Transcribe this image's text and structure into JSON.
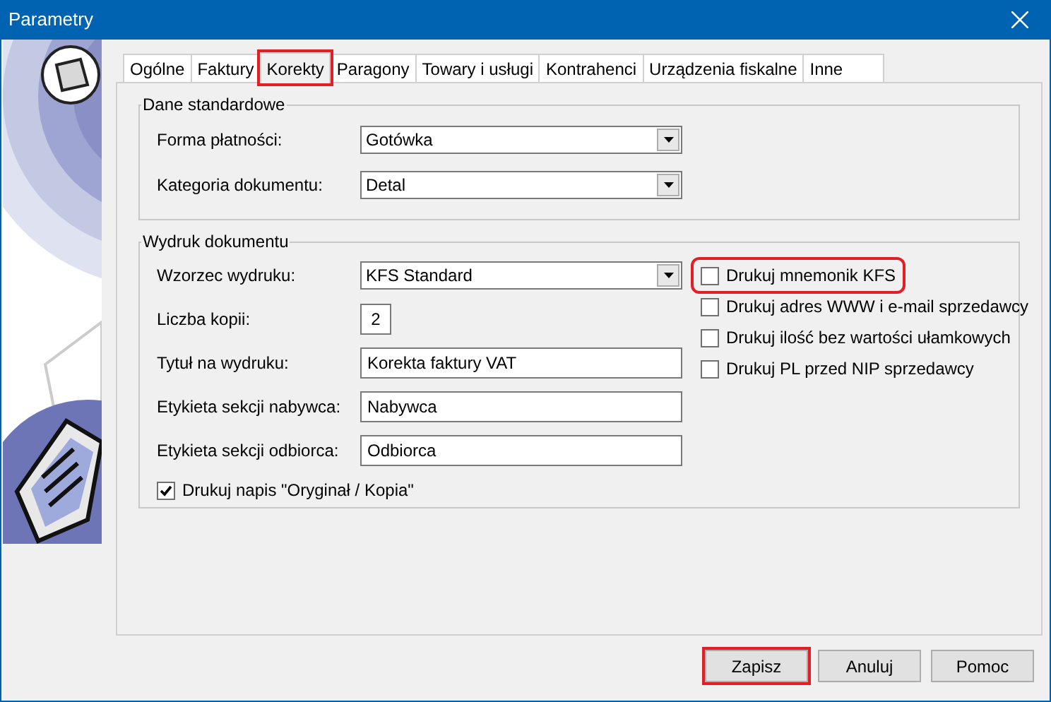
{
  "window": {
    "title": "Parametry"
  },
  "tabs": [
    {
      "label": "Ogólne",
      "selected": false,
      "highlighted": false
    },
    {
      "label": "Faktury",
      "selected": false,
      "highlighted": false
    },
    {
      "label": "Korekty",
      "selected": true,
      "highlighted": true
    },
    {
      "label": "Paragony",
      "selected": false,
      "highlighted": false
    },
    {
      "label": "Towary i usługi",
      "selected": false,
      "highlighted": false
    },
    {
      "label": "Kontrahenci",
      "selected": false,
      "highlighted": false
    },
    {
      "label": "Urządzenia fiskalne",
      "selected": false,
      "highlighted": false
    },
    {
      "label": "Inne",
      "selected": false,
      "highlighted": false
    }
  ],
  "standard_data": {
    "title": "Dane standardowe",
    "fields": [
      {
        "label": "Forma płatności:",
        "value": "Gotówka",
        "kind": "dropdown"
      },
      {
        "label": "Kategoria dokumentu:",
        "value": "Detal",
        "kind": "dropdown"
      }
    ]
  },
  "printout": {
    "title": "Wydruk dokumentu",
    "fields": [
      {
        "label": "Wzorzec wydruku:",
        "value": "KFS Standard",
        "kind": "dropdown"
      },
      {
        "label": "Liczba kopii:",
        "value": "2",
        "kind": "number"
      },
      {
        "label": "Tytuł na wydruku:",
        "value": "Korekta faktury VAT",
        "kind": "text"
      },
      {
        "label": "Etykieta sekcji nabywca:",
        "value": "Nabywca",
        "kind": "text"
      },
      {
        "label": "Etykieta sekcji odbiorca:",
        "value": "Odbiorca",
        "kind": "text"
      }
    ],
    "bottom_checkbox": {
      "label": "Drukuj napis \"Oryginał / Kopia\"",
      "checked": true
    },
    "options": [
      {
        "label": "Drukuj mnemonik KFS",
        "checked": false,
        "highlighted": true
      },
      {
        "label": "Drukuj adres WWW i e-mail sprzedawcy",
        "checked": false,
        "highlighted": false
      },
      {
        "label": "Drukuj ilość bez wartości ułamkowych",
        "checked": false,
        "highlighted": false
      },
      {
        "label": "Drukuj PL przed NIP sprzedawcy",
        "checked": false,
        "highlighted": false
      }
    ]
  },
  "buttons": [
    {
      "label": "Zapisz",
      "highlighted": true
    },
    {
      "label": "Anuluj",
      "highlighted": false
    },
    {
      "label": "Pomoc",
      "highlighted": false
    }
  ]
}
